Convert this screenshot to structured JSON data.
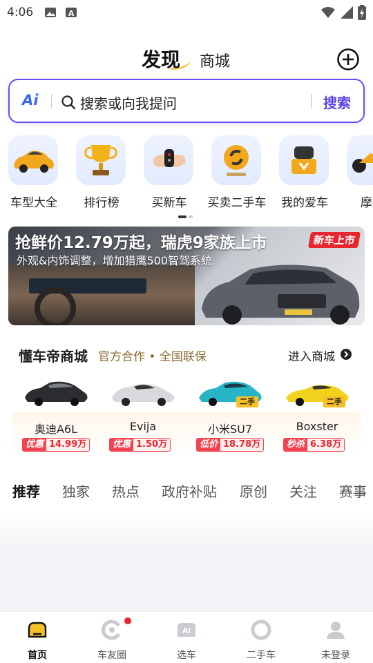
{
  "status": {
    "time": "4:06"
  },
  "header": {
    "tab_discover": "发现",
    "tab_mall": "商城"
  },
  "search": {
    "ai_label": "Ai",
    "placeholder": "搜索或向我提问",
    "button": "搜索"
  },
  "categories": [
    {
      "label": "车型大全",
      "icon": "car-icon"
    },
    {
      "label": "排行榜",
      "icon": "trophy-icon"
    },
    {
      "label": "买新车",
      "icon": "car-key-icon"
    },
    {
      "label": "买卖二手车",
      "icon": "used-car-icon"
    },
    {
      "label": "我的爱车",
      "icon": "garage-icon"
    },
    {
      "label": "摩托",
      "icon": "motorcycle-icon"
    }
  ],
  "banner": {
    "title": "抢鲜价12.79万起，瑞虎9家族上市",
    "subtitle": "外观&内饰调整，增加猎鹰500智驾系统",
    "badge": "新车上市"
  },
  "mall": {
    "brand": "懂车帝商城",
    "subtitle": "官方合作 • 全国联保",
    "enter": "进入商城",
    "products": [
      {
        "name": "奥迪A6L",
        "tag": "优惠",
        "price": "14.99万",
        "used": false,
        "color": "#2b2d31"
      },
      {
        "name": "Evija",
        "tag": "优惠",
        "price": "1.50万",
        "used": false,
        "color": "#d8d9dc"
      },
      {
        "name": "小米SU7",
        "tag": "低价",
        "price": "18.78万",
        "used": true,
        "used_label": "二手",
        "color": "#27b4c6"
      },
      {
        "name": "Boxster",
        "tag": "秒杀",
        "price": "6.38万",
        "used": true,
        "used_label": "二手",
        "color": "#f2d21c"
      }
    ]
  },
  "feed_tabs": [
    "推荐",
    "独家",
    "热点",
    "政府补贴",
    "原创",
    "关注",
    "赛事"
  ],
  "bottom_nav": [
    {
      "label": "首页",
      "icon": "home-icon",
      "active": true
    },
    {
      "label": "车友圈",
      "icon": "community-icon",
      "badge": true
    },
    {
      "label": "选车",
      "icon": "select-car-icon"
    },
    {
      "label": "二手车",
      "icon": "used-car-nav-icon"
    },
    {
      "label": "未登录",
      "icon": "user-icon"
    }
  ],
  "colors": {
    "accent": "#6a4df0",
    "price_red": "#e8262f",
    "brand_yellow": "#f6c028"
  }
}
